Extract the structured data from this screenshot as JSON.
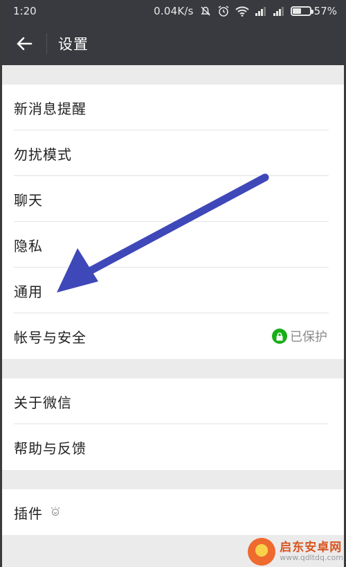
{
  "status_bar": {
    "time": "1:20",
    "network_speed": "0.04K/s",
    "battery_percent": "57%",
    "battery_level": 0.57
  },
  "toolbar": {
    "back_icon": "arrow-left-icon",
    "title": "设置"
  },
  "groups": [
    {
      "items": [
        {
          "label": "新消息提醒"
        },
        {
          "label": "勿扰模式"
        },
        {
          "label": "聊天"
        },
        {
          "label": "隐私"
        },
        {
          "label": "通用"
        },
        {
          "label": "帐号与安全",
          "status": "已保护",
          "status_icon": "lock-shield-icon"
        }
      ]
    },
    {
      "items": [
        {
          "label": "关于微信"
        },
        {
          "label": "帮助与反馈"
        }
      ]
    },
    {
      "items": [
        {
          "label": "插件",
          "icon": "plugin-bulb-icon"
        }
      ]
    }
  ],
  "annotation": {
    "arrow_color": "#3f48b8",
    "points_to": "通用"
  },
  "watermark": {
    "title": "启东安卓网",
    "url": "www.qdltdq.com"
  },
  "colors": {
    "toolbar_bg": "#393a3f",
    "page_bg": "#ebebeb",
    "secure_green": "#1aad19"
  }
}
